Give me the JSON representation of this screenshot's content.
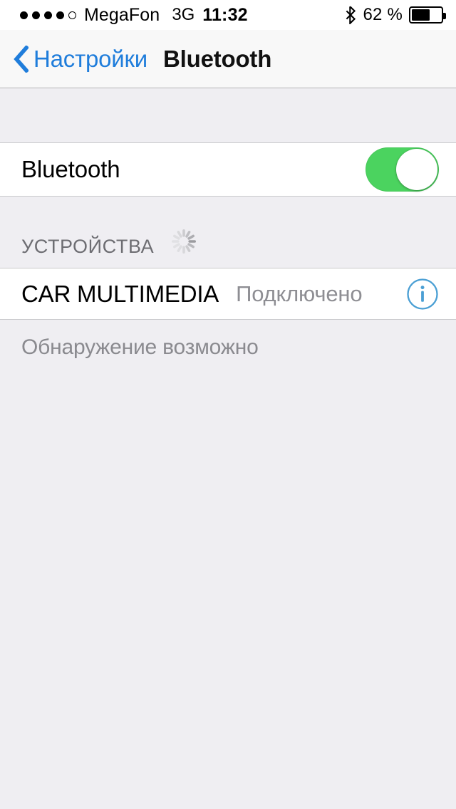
{
  "status_bar": {
    "signal_dots_filled": 4,
    "signal_dots_total": 5,
    "carrier": "MegaFon",
    "network_type": "3G",
    "time": "11:32",
    "bluetooth_icon": "bluetooth-icon",
    "battery_percent_label": "62 %",
    "battery_level": 62
  },
  "nav": {
    "back_icon": "chevron-left-icon",
    "back_label": "Настройки",
    "title": "Bluetooth"
  },
  "main": {
    "bluetooth_row": {
      "label": "Bluetooth",
      "toggle_on": true,
      "toggle_on_color": "#4bd35f"
    },
    "devices_section": {
      "header": "УСТРОЙСТВА",
      "spinner_icon": "activity-indicator-icon",
      "devices": [
        {
          "name": "CAR MULTIMEDIA",
          "status": "Подключено",
          "info_icon": "info-circle-icon",
          "info_icon_color": "#4a9fd4"
        }
      ]
    },
    "footer_note": "Обнаружение возможно"
  },
  "colors": {
    "accent_blue": "#1f7ddb",
    "toggle_green": "#4bd35f",
    "gray_text": "#8e8e93",
    "page_background": "#efeef2"
  }
}
